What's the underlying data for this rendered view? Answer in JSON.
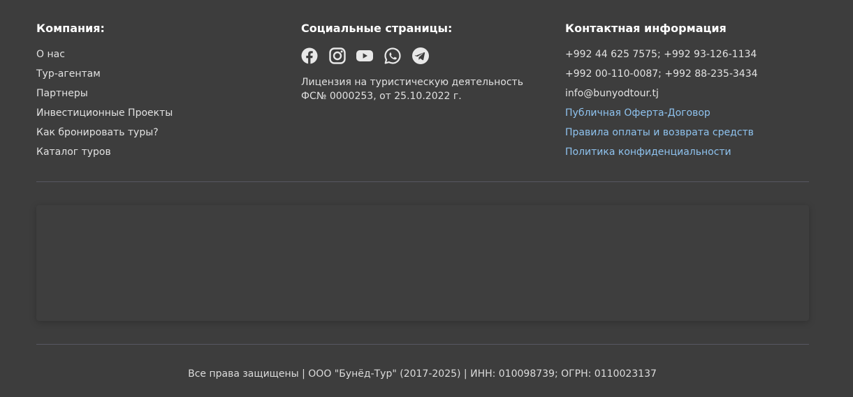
{
  "footer": {
    "company": {
      "title": "Компания:",
      "links": [
        "О нас",
        "Тур-агентам",
        "Партнеры",
        "Инвестиционные Проекты",
        "Как бронировать туры?",
        "Каталог туров"
      ]
    },
    "social": {
      "title": "Социальные страницы:",
      "icons": [
        "facebook-icon",
        "instagram-icon",
        "youtube-icon",
        "whatsapp-icon",
        "telegram-icon"
      ],
      "license": "Лицензия на туристическую деятельность ФС№ 0000253, от 25.10.2022 г."
    },
    "contacts": {
      "title": "Контактная информация",
      "phones_1": "+992 44 625 7575; +992 93-126-1134",
      "phones_2": "+992 00-110-0087; +992 88-235-3434",
      "email": "info@bunyodtour.tj",
      "offer": "Публичная Оферта-Договор",
      "payment_rules": "Правила оплаты и возврата средств",
      "privacy": "Политика конфиденциальности"
    },
    "copyright": "Все права защищены | ООО \"Бунёд-Тур\" (2017-2025) | ИНН: 010098739; ОГРН: 0110023137"
  },
  "colors": {
    "background": "#3d3d3d",
    "link_blue": "#8fc3ef",
    "icon": "#e8e8e8",
    "divider": "#575762"
  }
}
